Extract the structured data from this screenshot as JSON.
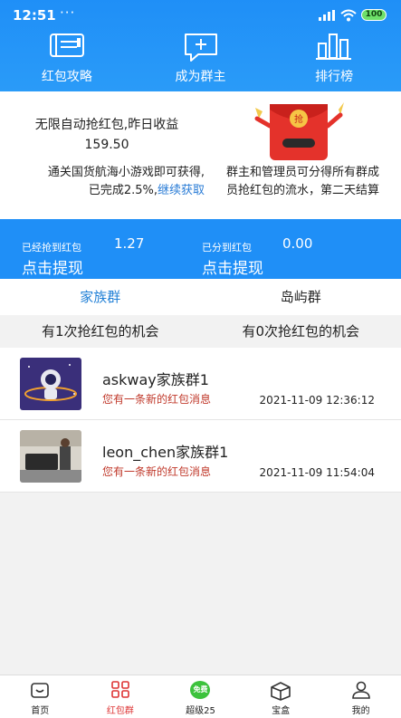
{
  "status": {
    "time": "12:51",
    "dots": "···",
    "battery": "100"
  },
  "topnav": [
    {
      "label": "红包攻略",
      "icon": "book-icon"
    },
    {
      "label": "成为群主",
      "icon": "chat-plus-icon"
    },
    {
      "label": "排行榜",
      "icon": "bar-chart-icon"
    }
  ],
  "promo": {
    "line1": "无限自动抢红包,昨日收益",
    "line2": "159.50",
    "left_desc_1": "通关国货航海小游戏即可获得,",
    "left_desc_2": "已完成2.5%,",
    "left_link": "继续获取",
    "right_desc_1": "群主和管理员可分得所有群成",
    "right_desc_2": "员抢红包的流水，第二天结算",
    "redpack_char": "抢"
  },
  "cash": {
    "grabbed_label": "已经抢到红包",
    "grabbed_value": "1.27",
    "grabbed_action": "点击提现",
    "shared_label": "已分到红包",
    "shared_value": "0.00",
    "shared_action": "点击提现"
  },
  "tabs": [
    {
      "label": "家族群"
    },
    {
      "label": "岛屿群"
    }
  ],
  "chances": [
    "有1次抢红包的机会",
    "有0次抢红包的机会"
  ],
  "groups": [
    {
      "name": "askway家族群1",
      "message": "您有一条新的红包消息",
      "time": "2021-11-09 12:36:12"
    },
    {
      "name": "leon_chen家族群1",
      "message": "您有一条新的红包消息",
      "time": "2021-11-09 11:54:04"
    }
  ],
  "bottomnav": [
    {
      "label": "首页"
    },
    {
      "label": "红包群"
    },
    {
      "label": "超级25",
      "badge": "免费"
    },
    {
      "label": "宝盒"
    },
    {
      "label": "我的"
    }
  ]
}
